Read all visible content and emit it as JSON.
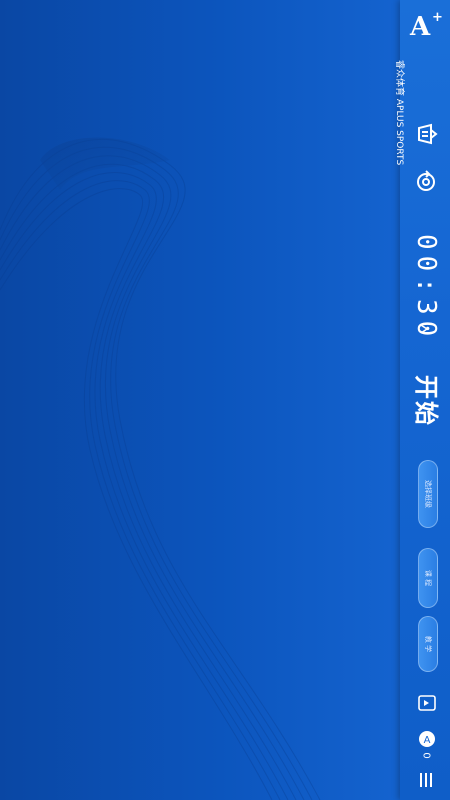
{
  "brand": {
    "logo_text": "A",
    "logo_sup": "+",
    "sub_text": "睿众体育 APLUS SPORTS"
  },
  "controls": {
    "timer": "00:30",
    "start": "开始",
    "pills": [
      "选择班级",
      "课 程",
      "教 学"
    ]
  },
  "footer": {
    "user_count": "0"
  },
  "colors": {
    "accent": "#1566d2",
    "background": "#0b4fb0"
  }
}
